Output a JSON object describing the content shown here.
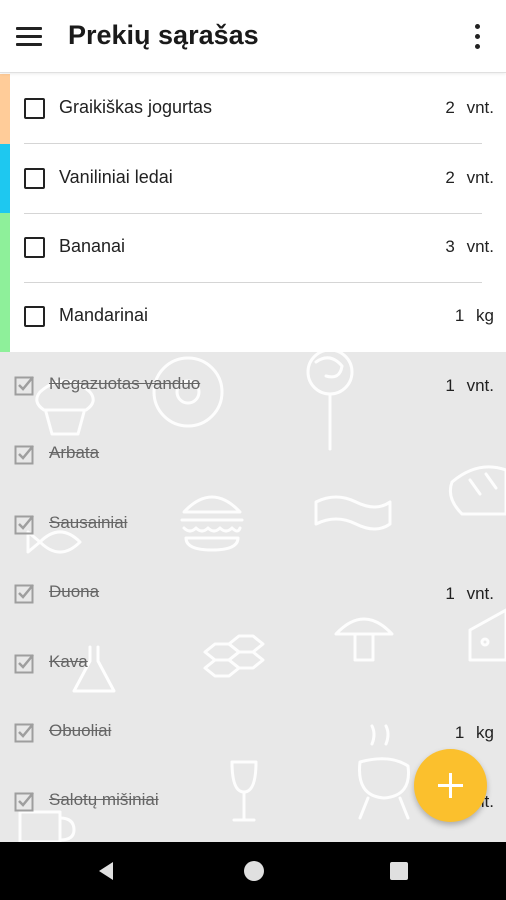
{
  "app": {
    "title": "Prekių sąrašas"
  },
  "active_items": [
    {
      "name": "Graikiškas jogurtas",
      "qty": "2 vnt.",
      "color": "#ffcc99"
    },
    {
      "name": "Vaniliniai ledai",
      "qty": "2 vnt.",
      "color": "#1ec8f0"
    },
    {
      "name": "Bananai",
      "qty": "3 vnt.",
      "color": "#8ef09a"
    },
    {
      "name": "Mandarinai",
      "qty": "1 kg",
      "color": "#8ef09a"
    }
  ],
  "completed_items": [
    {
      "name": "Negazuotas vanduo",
      "qty": "1 vnt."
    },
    {
      "name": "Arbata",
      "qty": ""
    },
    {
      "name": "Sausainiai",
      "qty": ""
    },
    {
      "name": "Duona",
      "qty": "1 vnt."
    },
    {
      "name": "Kava",
      "qty": ""
    },
    {
      "name": "Obuoliai",
      "qty": "1 kg"
    },
    {
      "name": "Salotų mišiniai",
      "qty": "1 vnt."
    }
  ],
  "fab": {
    "icon": "plus-icon",
    "color": "#fbc02d"
  },
  "icons": {
    "menu": "menu-icon",
    "more": "more-vert-icon"
  }
}
